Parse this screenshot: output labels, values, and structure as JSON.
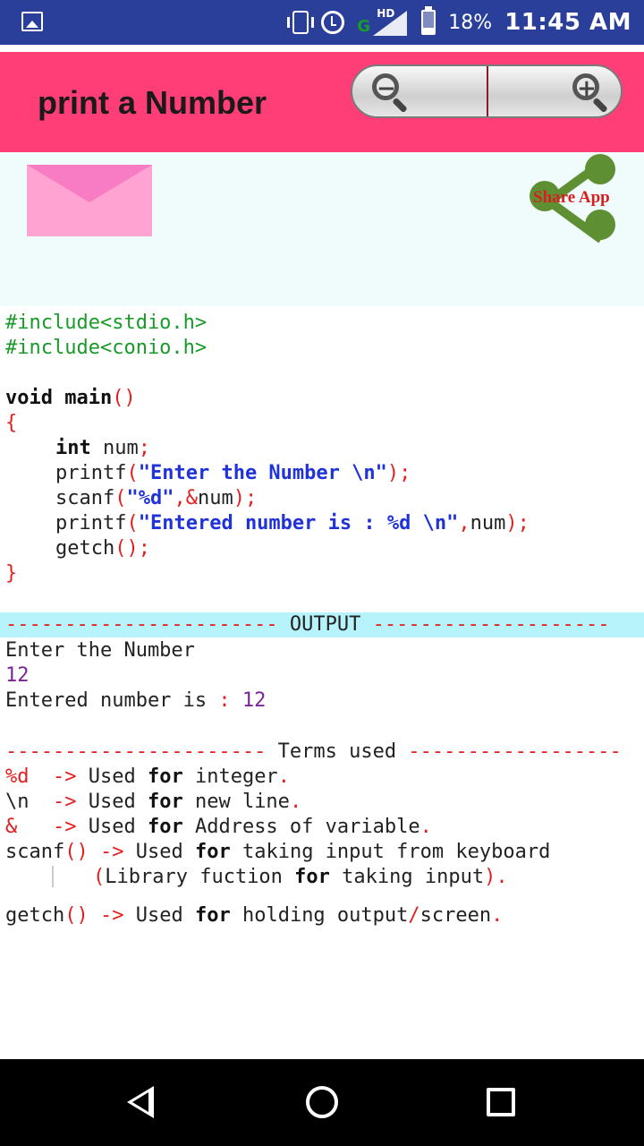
{
  "status_bar": {
    "network_label": "G",
    "hd_label": "HD",
    "battery": "18%",
    "time": "11:45 AM"
  },
  "app_bar": {
    "title": "print a Number",
    "zoom_out_symbol": "−",
    "zoom_in_symbol": "+"
  },
  "share": {
    "label": "Share App"
  },
  "code": {
    "include1": "#include<stdio.h>",
    "include2": "#include<conio.h>",
    "main_sig": "void main",
    "main_parens": "()",
    "open_brace": "{",
    "int_kw": "int",
    "int_var": " num",
    "semi": ";",
    "printf1_fn": "printf",
    "printf1_open": "(",
    "printf1_str": "\"Enter the Number \\n\"",
    "printf1_close": ");",
    "scanf_fn": "scanf",
    "scanf_open": "(",
    "scanf_str": "\"%d\"",
    "scanf_comma": ",&",
    "scanf_var": "num",
    "scanf_close": ");",
    "printf2_fn": "printf",
    "printf2_open": "(",
    "printf2_str": "\"Entered number is : %d \\n\"",
    "printf2_comma": ",",
    "printf2_var": "num",
    "printf2_close": ");",
    "getch_fn": "getch",
    "getch_close": "();",
    "close_brace": "}"
  },
  "output": {
    "dashes_left": "-----------------------",
    "label": " OUTPUT ",
    "dashes_right": "--------------------",
    "line1": "Enter the Number",
    "line2": "12",
    "line3_text": "Entered number is ",
    "line3_colon": ":",
    "line3_val": " 12"
  },
  "terms": {
    "dashes_left": "----------------------",
    "label": " Terms used ",
    "dashes_right": "------------------",
    "t1_sym": "%d",
    "t1_arrow": "  ->",
    "t1_text1": " Used ",
    "t1_for": "for",
    "t1_text2": " integer",
    "t1_dot": ".",
    "t2_sym": "\\n",
    "t2_arrow": "  ->",
    "t2_text1": " Used ",
    "t2_for": "for",
    "t2_text2": " new line",
    "t2_dot": ".",
    "t3_sym": "&",
    "t3_arrow": "   ->",
    "t3_text1": " Used ",
    "t3_for": "for",
    "t3_text2": " Address of variable",
    "t3_dot": ".",
    "t4_fn": "scanf",
    "t4_paren": "()",
    "t4_arrow": " ->",
    "t4_text1": " Used ",
    "t4_for": "for",
    "t4_text2": " taking input from keyboard",
    "t5_open": "(",
    "t5_text1": "Library fuction ",
    "t5_for": "for",
    "t5_text2": " taking input",
    "t5_close": ").",
    "t6_fn": "getch",
    "t6_paren": "()",
    "t6_arrow": " ->",
    "t6_text1": " Used ",
    "t6_for": "for",
    "t6_text2": " holding output",
    "t6_slash": "/",
    "t6_text3": "screen",
    "t6_dot": "."
  },
  "colors": {
    "status_bar": "#2a3f9a",
    "app_bar": "#ff3e78",
    "panel": "#f0fbfc",
    "output_bar": "#b7f3fb",
    "share_green": "#5e8f33"
  }
}
